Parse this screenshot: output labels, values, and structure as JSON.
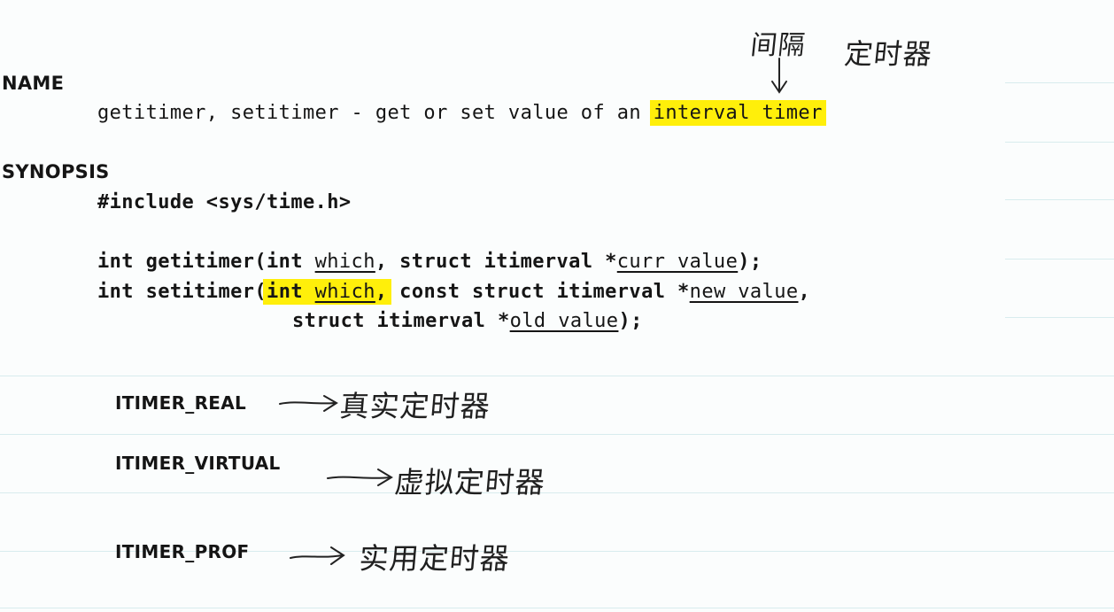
{
  "name_section": {
    "heading": "NAME",
    "text_plain": "getitimer, setitimer - get or set value of an ",
    "text_highlight": "interval timer"
  },
  "synopsis_section": {
    "heading": "SYNOPSIS",
    "include_line": "#include <sys/time.h>",
    "getitimer_line": {
      "part1": "int getitimer(int ",
      "param1": "which",
      "part2": ", struct itimerval *",
      "param2": "curr value",
      "part3": ");"
    },
    "setitimer_line": {
      "part1": "int setitimer(",
      "highlight_int": "int ",
      "param1": "which",
      "highlight_comma": ",",
      "part2": " const struct itimerval *",
      "param2": "new value",
      "part3": ","
    },
    "setitimer_cont": {
      "part1": "struct itimerval *",
      "param": "old value",
      "part2": ");"
    }
  },
  "annotations": {
    "top_label_interval": "间隔",
    "top_label_timer": "定时器",
    "items": [
      {
        "constant": "ITIMER_REAL",
        "note": "真实定时器"
      },
      {
        "constant": "ITIMER_VIRTUAL",
        "note": "虚拟定时器"
      },
      {
        "constant": "ITIMER_PROF",
        "note": "实用定时器"
      }
    ]
  },
  "colors": {
    "highlight": "#ffef0a",
    "text": "#151515",
    "rules": "#d8ecee",
    "background": "#fbfdfd"
  }
}
